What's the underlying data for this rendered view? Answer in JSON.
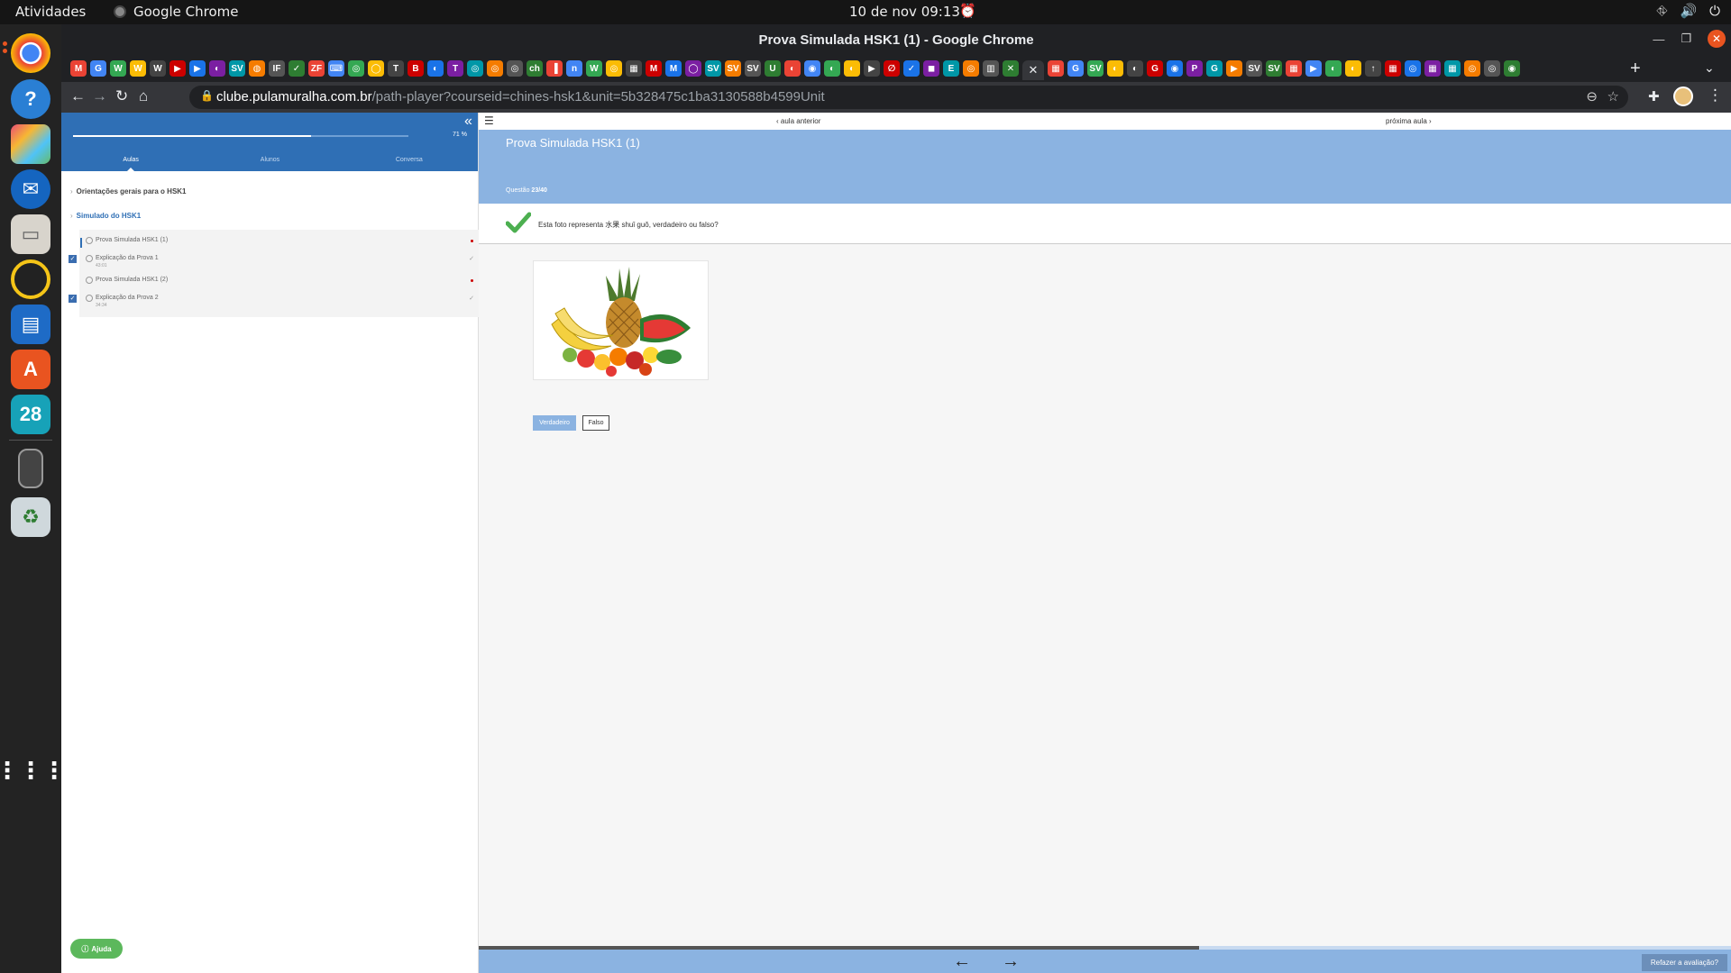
{
  "system": {
    "activities": "Atividades",
    "app_name": "Google Chrome",
    "clock": "10 de nov  09:13",
    "dock_calendar_day": "28"
  },
  "browser": {
    "window_title": "Prova Simulada HSK1 (1) - Google Chrome",
    "url_host": "clube.pulamuralha.com.br",
    "url_path": "/path-player?courseid=chines-hsk1&unit=5b328475c1ba3130588b4599Unit",
    "favicons": [
      "M",
      "G",
      "W",
      "W",
      "W",
      "▶",
      "▶",
      "◐",
      "SV",
      "◍",
      "IF",
      "✓",
      "ZF",
      "⌨",
      "◎",
      "◯",
      "T",
      "B",
      "◐",
      "T",
      "◎",
      "◎",
      "◎",
      "ch",
      "▐",
      "n",
      "W",
      "◎",
      "▦",
      "M",
      "M",
      "◯",
      "SV",
      "SV",
      "SV",
      "U",
      "◐",
      "◉",
      "◐",
      "◐",
      "▶",
      "∅",
      "✓",
      "◼",
      "E",
      "◎",
      "▥",
      "✕",
      "▦",
      "G",
      "SV",
      "◐",
      "◐",
      "G",
      "◉",
      "P",
      "G",
      "▶",
      "SV",
      "SV",
      "▦",
      "▶",
      "◐",
      "◐",
      "↑",
      "▦",
      "◎",
      "▦",
      "▦",
      "◎",
      "◎",
      "◉"
    ]
  },
  "sidebar": {
    "progress": 0.71,
    "progress_label": "71 %",
    "tabs": [
      "Aulas",
      "Alunos",
      "Conversa"
    ],
    "sections": [
      "Orientações gerais para o HSK1",
      "Simulado do HSK1"
    ],
    "lessons": [
      {
        "name": "Prova Simulada HSK1 (1)",
        "duration": "",
        "state": "current"
      },
      {
        "name": "Explicação da Prova 1",
        "duration": "43:01",
        "state": "done"
      },
      {
        "name": "Prova Simulada HSK1 (2)",
        "duration": "",
        "state": "pending"
      },
      {
        "name": "Explicação da Prova 2",
        "duration": "34:34",
        "state": "done"
      }
    ],
    "help_label": "Ajuda"
  },
  "main": {
    "prev_label": "aula anterior",
    "next_label": "próxima aula",
    "title": "Prova Simulada HSK1 (1)",
    "question_prefix": "Questão",
    "question_number": "23/40",
    "question_text": "Esta foto representa 水果 shuǐ guǒ, verdadeiro ou falso?",
    "answer_true": "Verdadeiro",
    "answer_false": "Falso",
    "bottom_progress": 0.575,
    "redo_label": "Refazer a avaliação?"
  },
  "colors": {
    "sidebar_header": "#2f6fb5",
    "banner": "#8bb3e1",
    "correct_check": "#4caf50",
    "help_button": "#5cb85c"
  }
}
